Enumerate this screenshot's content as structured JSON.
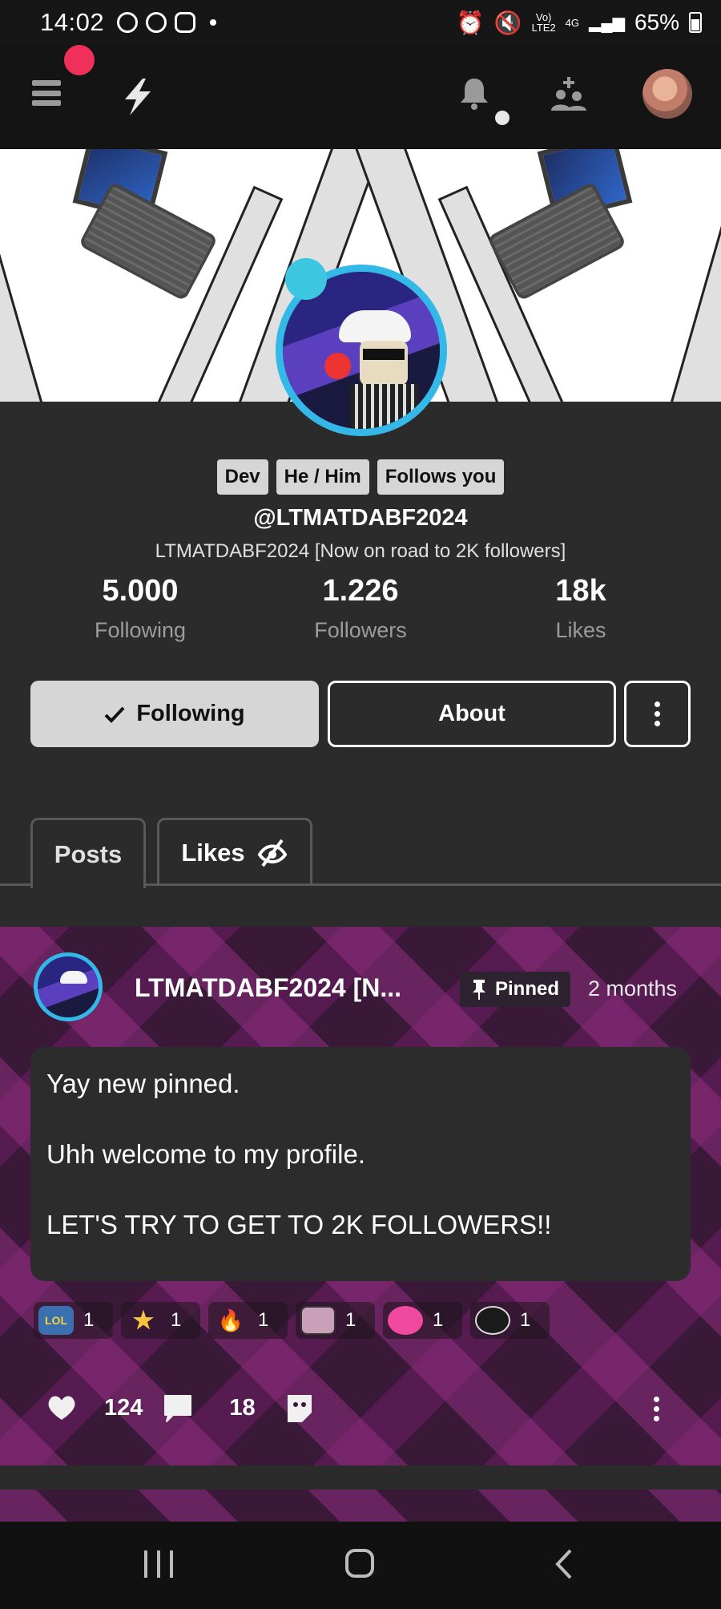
{
  "status_bar": {
    "time": "14:02",
    "network_top": "Vo)",
    "network_bottom": "LTE2",
    "network_gen": "4G",
    "battery": "65%"
  },
  "colors": {
    "accent_blue": "#33b8e8",
    "notification_red": "#f0305a",
    "button_light": "#d6d6d6",
    "post_purple": "#3a1838"
  },
  "profile": {
    "chips": [
      "Dev",
      "He / Him",
      "Follows you"
    ],
    "handle": "@LTMATDABF2024",
    "display_name": "LTMATDABF2024 [Now on road to 2K followers]",
    "stats": [
      {
        "value": "5.000",
        "label": "Following"
      },
      {
        "value": "1.226",
        "label": "Followers"
      },
      {
        "value": "18k",
        "label": "Likes"
      }
    ],
    "following_button": "Following",
    "about_button": "About"
  },
  "tabs": [
    {
      "label": "Posts"
    },
    {
      "label": "Likes"
    }
  ],
  "post": {
    "author": "LTMATDABF2024 [N...",
    "pinned_label": "Pinned",
    "time": "2 months",
    "body": [
      "Yay new pinned.",
      "Uhh welcome to my profile.",
      "LET'S TRY TO GET TO 2K FOLLOWERS!!"
    ],
    "reactions": [
      {
        "icon": "lol-reaction-icon",
        "label": "LOL",
        "count": "1"
      },
      {
        "icon": "star-reaction-icon",
        "label": "★",
        "count": "1"
      },
      {
        "icon": "fire-reaction-icon",
        "label": "🔥",
        "count": "1"
      },
      {
        "icon": "sticker-reaction-icon",
        "label": "",
        "count": "1"
      },
      {
        "icon": "heart-face-reaction-icon",
        "label": "",
        "count": "1"
      },
      {
        "icon": "ghost-reaction-icon",
        "label": "",
        "count": "1"
      }
    ],
    "like_count": "124",
    "comment_count": "18"
  }
}
